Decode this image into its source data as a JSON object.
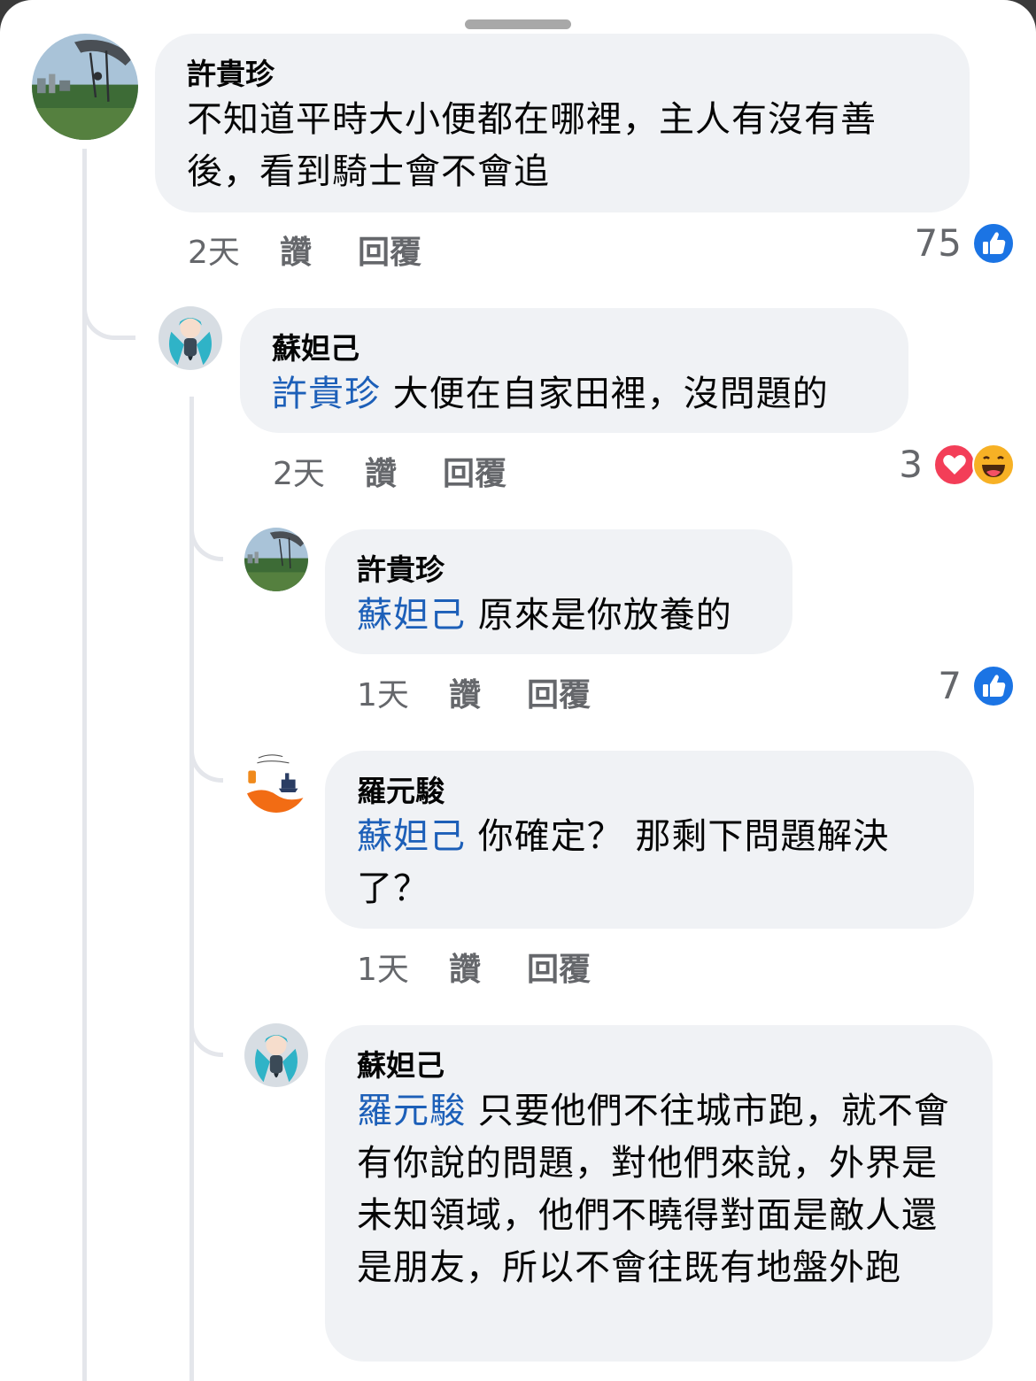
{
  "colors": {
    "bubble": "#f0f2f5",
    "mention": "#1c5fb8",
    "meta_text": "#65676b",
    "like_blue": "#1b74e4",
    "love_red": "#f33e58",
    "haha_yellow": "#f7b125"
  },
  "comments": [
    {
      "author": "許貴珍",
      "avatar_icon": "landscape-photo-avatar",
      "mention": "",
      "text": "不知道平時大小便都在哪裡，主人有沒有善後，看到騎士會不會追",
      "time": "2天",
      "like_label": "讚",
      "reply_label": "回覆",
      "reaction_count": "75",
      "reaction_icons": [
        "like-icon"
      ]
    },
    {
      "author": "蘇妲己",
      "avatar_icon": "anime-character-avatar",
      "mention": "許貴珍",
      "text": "大便在自家田裡，沒問題的",
      "time": "2天",
      "like_label": "讚",
      "reply_label": "回覆",
      "reaction_count": "3",
      "reaction_icons": [
        "love-icon",
        "haha-icon"
      ]
    },
    {
      "author": "許貴珍",
      "avatar_icon": "landscape-photo-avatar",
      "mention": "蘇妲己",
      "text": "原來是你放養的",
      "time": "1天",
      "like_label": "讚",
      "reply_label": "回覆",
      "reaction_count": "7",
      "reaction_icons": [
        "like-icon"
      ]
    },
    {
      "author": "羅元駿",
      "avatar_icon": "cartoon-drawing-avatar",
      "mention": "蘇妲己",
      "text": "你確定？ 那剩下問題解決了？",
      "time": "1天",
      "like_label": "讚",
      "reply_label": "回覆",
      "reaction_count": "",
      "reaction_icons": []
    },
    {
      "author": "蘇妲己",
      "avatar_icon": "anime-character-avatar",
      "mention": "羅元駿",
      "text": "只要他們不往城市跑，就不會有你說的問題，對他們來說，外界是未知領域，他們不曉得對面是敵人還是朋友，所以不會往既有地盤外跑",
      "time": "",
      "like_label": "",
      "reply_label": "",
      "reaction_count": "",
      "reaction_icons": []
    }
  ]
}
